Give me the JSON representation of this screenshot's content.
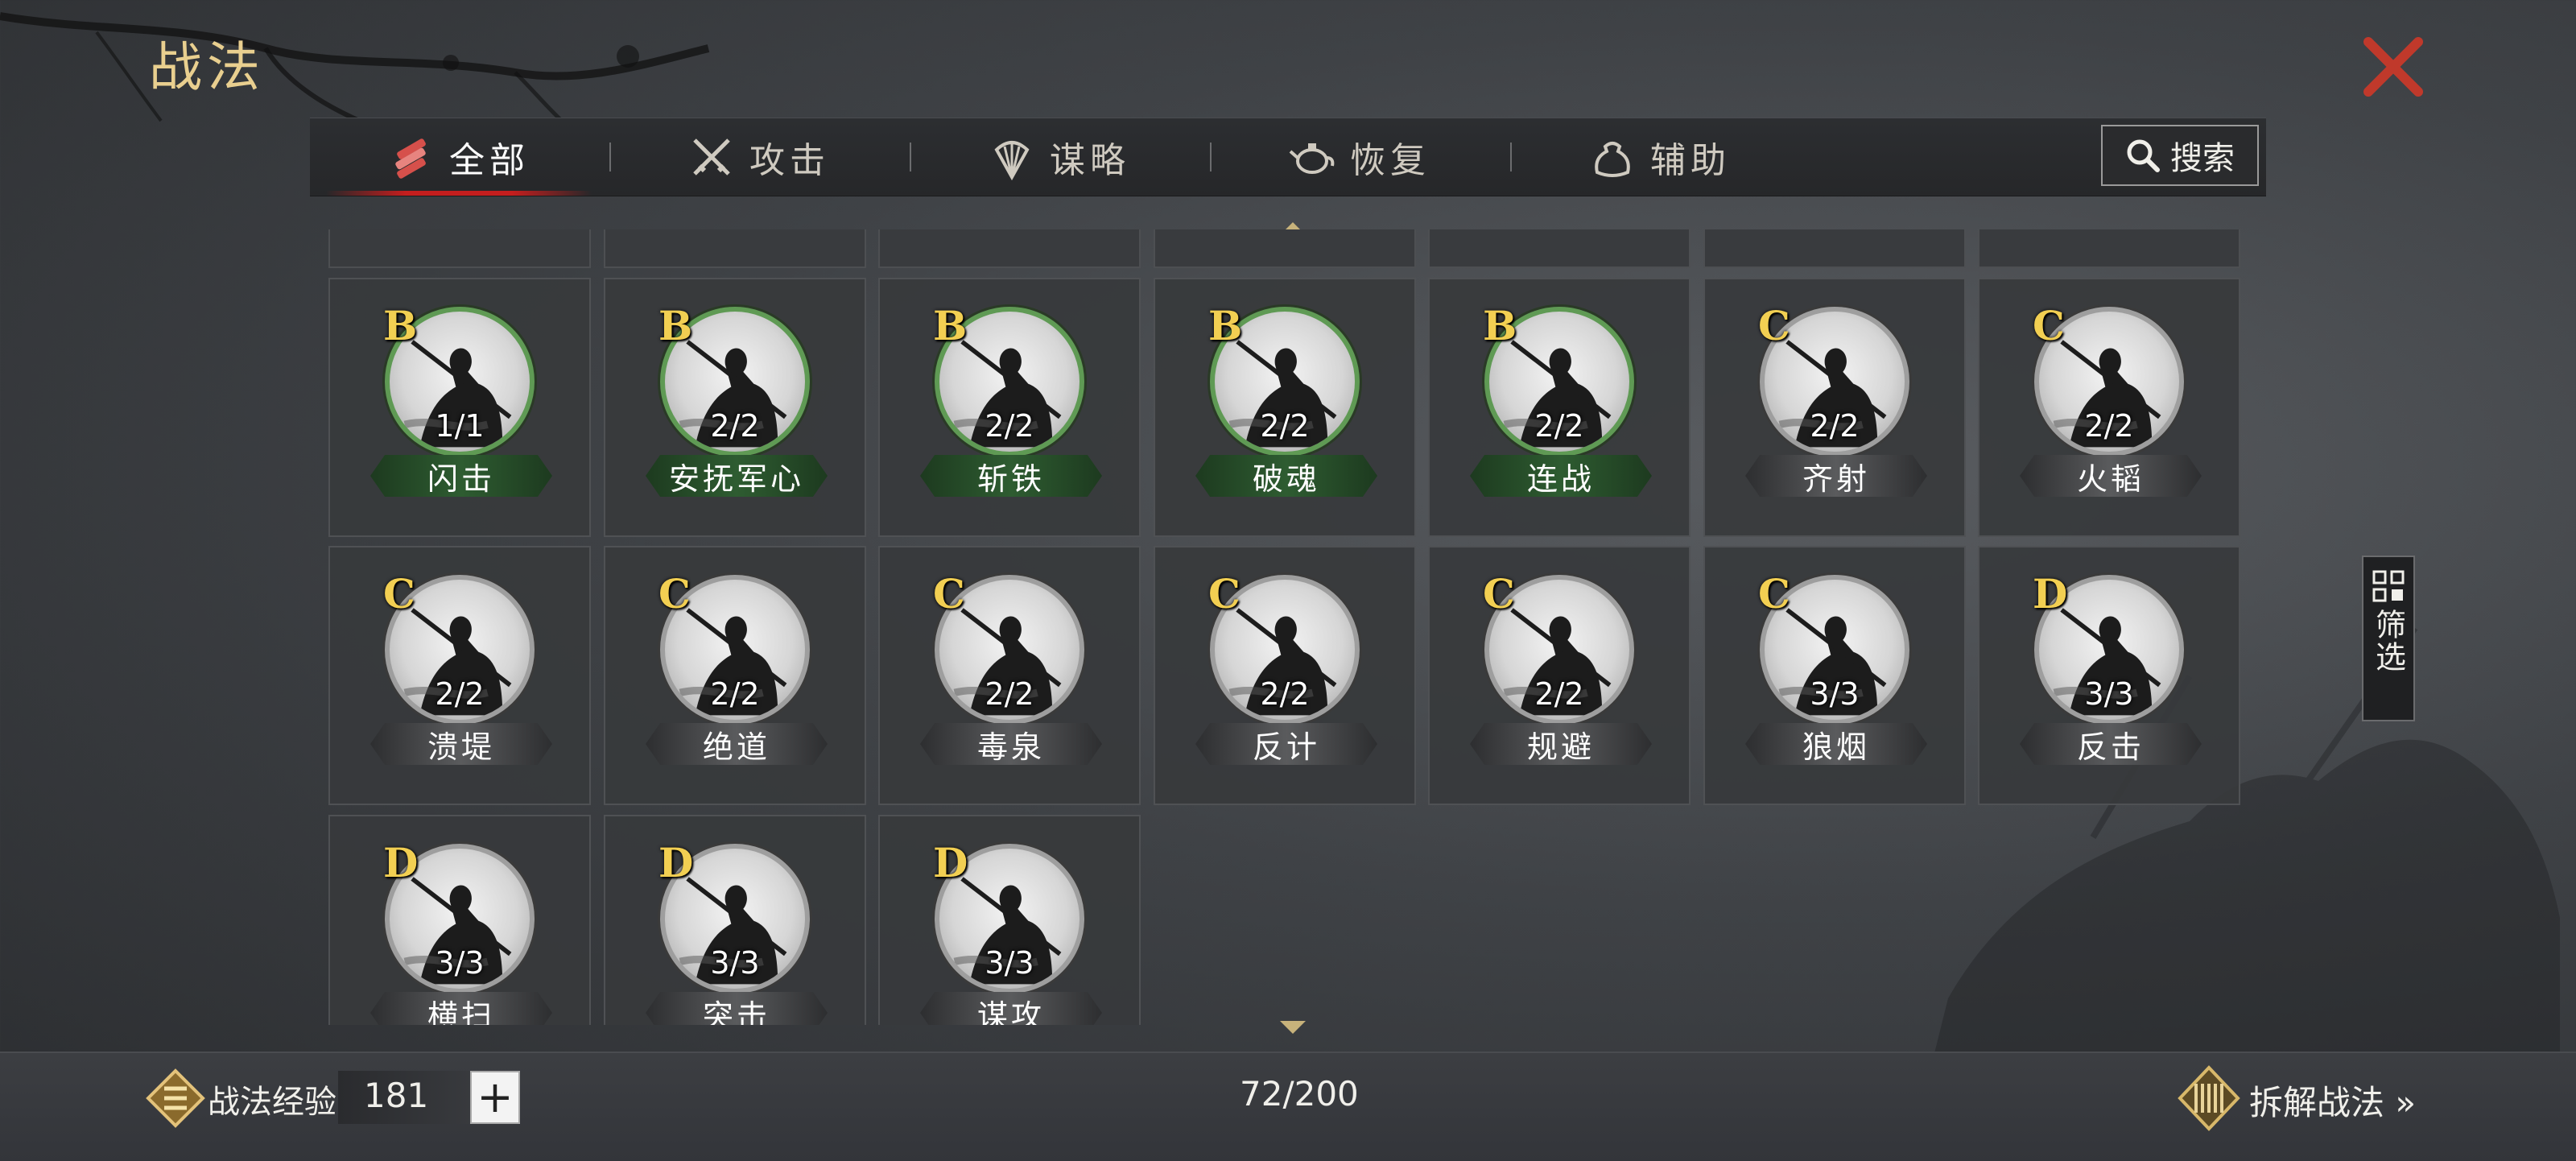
{
  "page": {
    "title": "战法"
  },
  "tabs": [
    {
      "label": "全部",
      "icon": "scroll-bundle-icon",
      "active": true
    },
    {
      "label": "攻击",
      "icon": "crossed-swords-icon",
      "active": false
    },
    {
      "label": "谋略",
      "icon": "feather-fan-icon",
      "active": false
    },
    {
      "label": "恢复",
      "icon": "teapot-icon",
      "active": false
    },
    {
      "label": "辅助",
      "icon": "pouch-icon",
      "active": false
    }
  ],
  "search": {
    "label": "搜索",
    "icon": "search-icon"
  },
  "filter": {
    "label": "筛选",
    "icon": "grid-filter-icon"
  },
  "tactics": [
    {
      "grade": "B",
      "level": "1/1",
      "name": "闪击",
      "rarity": "green"
    },
    {
      "grade": "B",
      "level": "2/2",
      "name": "安抚军心",
      "rarity": "green"
    },
    {
      "grade": "B",
      "level": "2/2",
      "name": "斩铁",
      "rarity": "green"
    },
    {
      "grade": "B",
      "level": "2/2",
      "name": "破魂",
      "rarity": "green"
    },
    {
      "grade": "B",
      "level": "2/2",
      "name": "连战",
      "rarity": "green"
    },
    {
      "grade": "C",
      "level": "2/2",
      "name": "齐射",
      "rarity": "grey"
    },
    {
      "grade": "C",
      "level": "2/2",
      "name": "火韬",
      "rarity": "grey"
    },
    {
      "grade": "C",
      "level": "2/2",
      "name": "溃堤",
      "rarity": "grey"
    },
    {
      "grade": "C",
      "level": "2/2",
      "name": "绝道",
      "rarity": "grey"
    },
    {
      "grade": "C",
      "level": "2/2",
      "name": "毒泉",
      "rarity": "grey"
    },
    {
      "grade": "C",
      "level": "2/2",
      "name": "反计",
      "rarity": "grey"
    },
    {
      "grade": "C",
      "level": "2/2",
      "name": "规避",
      "rarity": "grey"
    },
    {
      "grade": "C",
      "level": "3/3",
      "name": "狼烟",
      "rarity": "grey"
    },
    {
      "grade": "D",
      "level": "3/3",
      "name": "反击",
      "rarity": "grey"
    },
    {
      "grade": "D",
      "level": "3/3",
      "name": "横扫",
      "rarity": "grey"
    },
    {
      "grade": "D",
      "level": "3/3",
      "name": "突击",
      "rarity": "grey"
    },
    {
      "grade": "D",
      "level": "3/3",
      "name": "谋攻",
      "rarity": "grey"
    }
  ],
  "footer": {
    "exp_label": "战法经验",
    "exp_value": "181",
    "plus_label": "+",
    "count": "72/200",
    "dismantle_label": "拆解战法 »"
  },
  "colors": {
    "accent_gold": "#e9cf8f",
    "grade_gold": "#f2cf52",
    "tab_active_red": "#c41e1e",
    "close_red": "#c0392b"
  }
}
